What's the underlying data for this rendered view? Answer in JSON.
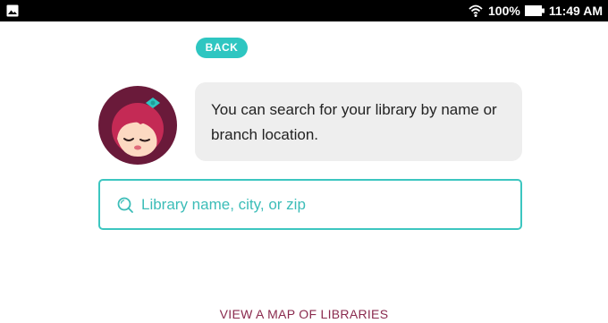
{
  "status_bar": {
    "battery": "100%",
    "time": "11:49 AM",
    "icons": [
      "image-icon",
      "wifi-icon",
      "battery-icon"
    ]
  },
  "back_button": {
    "label": "BACK"
  },
  "avatar": {
    "icon": "libby-avatar-icon"
  },
  "message": {
    "text": "You can search for your library by name or branch location."
  },
  "search": {
    "placeholder": "Library name, city, or zip",
    "value": "",
    "icon": "search-icon"
  },
  "map_link": {
    "label": "VIEW A MAP OF LIBRARIES"
  },
  "colors": {
    "accent": "#2ec6c1",
    "link": "#8a2a4e",
    "bubble": "#eeeeee",
    "status_bar": "#000000",
    "avatar_ring": "#6a1a3a",
    "avatar_hair": "#c42a55"
  }
}
